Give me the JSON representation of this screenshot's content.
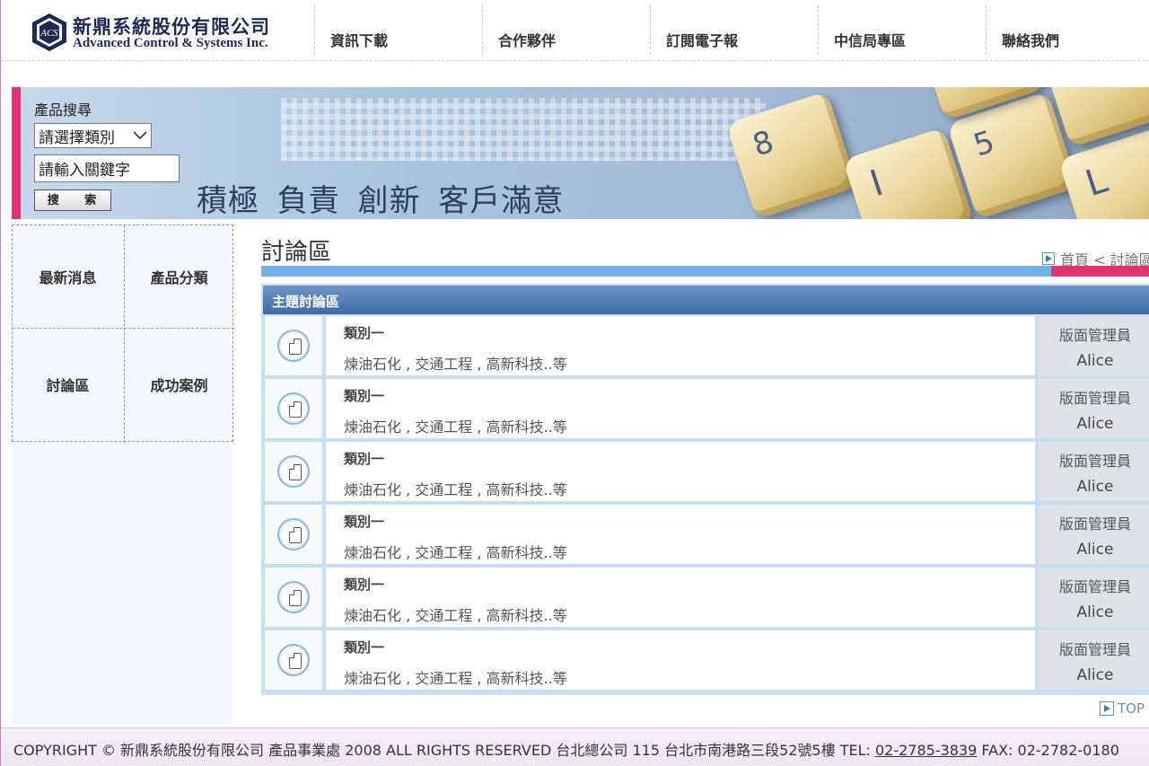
{
  "header": {
    "logo_cn": "新鼎系統股份有限公司",
    "logo_en": "Advanced Control & Systems Inc.",
    "logo_emblem": "ACS"
  },
  "nav": [
    {
      "label": "資訊下載"
    },
    {
      "label": "合作夥伴"
    },
    {
      "label": "訂閱電子報"
    },
    {
      "label": "中信局專區"
    },
    {
      "label": "聯絡我們"
    }
  ],
  "search": {
    "label": "產品搜尋",
    "select_value": "請選擇類別",
    "keyword_value": "請輸入關鍵字",
    "button_label": "搜 索"
  },
  "banner": {
    "slogan": "積極 負責 創新 客戶滿意",
    "keys": [
      "8",
      "I",
      "5",
      "L"
    ]
  },
  "sidebar": {
    "items": [
      {
        "label": "最新消息"
      },
      {
        "label": "產品分類"
      },
      {
        "label": "討論區"
      },
      {
        "label": "成功案例"
      }
    ]
  },
  "main": {
    "title": "討論區",
    "breadcrumb": "首頁 < 討論區",
    "forum_header": "主題討論區",
    "rows": [
      {
        "name": "類別一",
        "desc": "煉油石化 , 交通工程 , 高新科技..等",
        "role": "版面管理員",
        "admin": "Alice"
      },
      {
        "name": "類別一",
        "desc": "煉油石化 , 交通工程 , 高新科技..等",
        "role": "版面管理員",
        "admin": "Alice"
      },
      {
        "name": "類別一",
        "desc": "煉油石化 , 交通工程 , 高新科技..等",
        "role": "版面管理員",
        "admin": "Alice"
      },
      {
        "name": "類別一",
        "desc": "煉油石化 , 交通工程 , 高新科技..等",
        "role": "版面管理員",
        "admin": "Alice"
      },
      {
        "name": "類別一",
        "desc": "煉油石化 , 交通工程 , 高新科技..等",
        "role": "版面管理員",
        "admin": "Alice"
      },
      {
        "name": "類別一",
        "desc": "煉油石化 , 交通工程 , 高新科技..等",
        "role": "版面管理員",
        "admin": "Alice"
      }
    ],
    "top_link": "TOP"
  },
  "footer": {
    "text_before": "COPYRIGHT © 新鼎系統股份有限公司 產品事業處 2008 ALL RIGHTS RESERVED 台北總公司 115 台北市南港路三段52號5樓 TEL: ",
    "tel": "02-2785-3839",
    "text_after": " FAX: 02-2782-0180"
  },
  "colors": {
    "accent_pink": "#e0336f",
    "accent_blue": "#74b0e8",
    "header_blue": "#3e6aa3"
  }
}
